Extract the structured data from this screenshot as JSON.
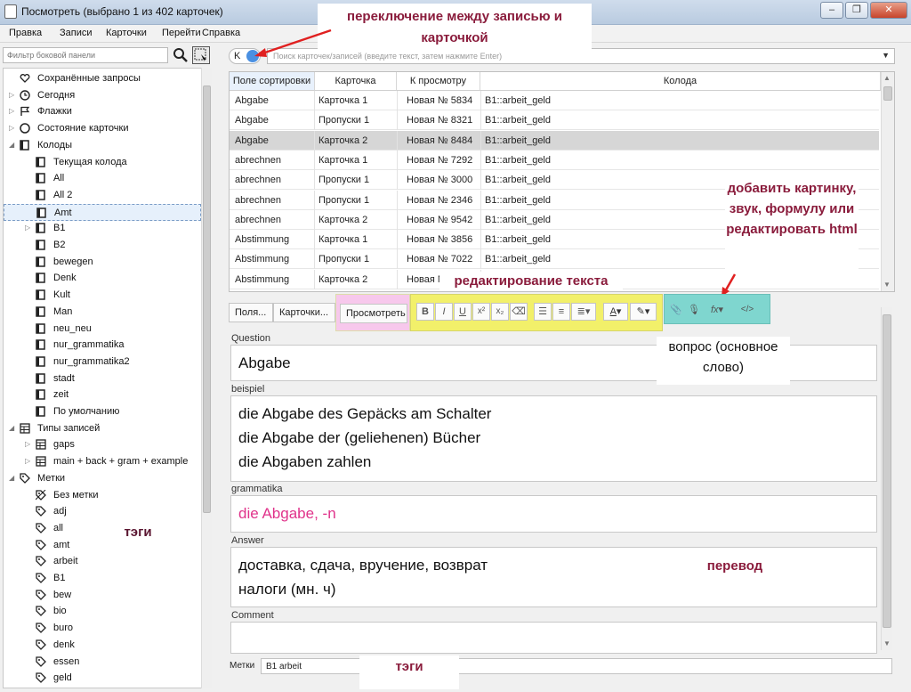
{
  "window": {
    "title": "Посмотреть (выбрано 1 из 402 карточек)",
    "controls": [
      "–",
      "❐",
      "✕"
    ]
  },
  "menu": [
    "Правка",
    "Записи",
    "Карточки",
    "Перейти",
    "Справка"
  ],
  "sidebar": {
    "filter_placeholder": "Фильтр боковой панели",
    "items": [
      {
        "label": "Сохранённые запросы",
        "icon": "heart-icon",
        "level": 0,
        "arrow": ""
      },
      {
        "label": "Сегодня",
        "icon": "clock-icon",
        "level": 0,
        "arrow": "▷"
      },
      {
        "label": "Флажки",
        "icon": "flag-icon",
        "level": 0,
        "arrow": "▷"
      },
      {
        "label": "Состояние карточки",
        "icon": "circle-icon",
        "level": 0,
        "arrow": "▷"
      },
      {
        "label": "Колоды",
        "icon": "deck-icon",
        "level": 0,
        "arrow": "◢"
      },
      {
        "label": "Текущая колода",
        "icon": "current-deck-icon",
        "level": 1,
        "arrow": ""
      },
      {
        "label": "All",
        "icon": "deck-icon",
        "level": 1,
        "arrow": ""
      },
      {
        "label": "All 2",
        "icon": "deck-icon",
        "level": 1,
        "arrow": ""
      },
      {
        "label": "Amt",
        "icon": "deck-icon",
        "level": 1,
        "arrow": "",
        "selected": true
      },
      {
        "label": "B1",
        "icon": "deck-icon",
        "level": 1,
        "arrow": "▷"
      },
      {
        "label": "B2",
        "icon": "deck-icon",
        "level": 1,
        "arrow": ""
      },
      {
        "label": "bewegen",
        "icon": "deck-icon",
        "level": 1,
        "arrow": ""
      },
      {
        "label": "Denk",
        "icon": "deck-icon",
        "level": 1,
        "arrow": ""
      },
      {
        "label": "Kult",
        "icon": "deck-icon",
        "level": 1,
        "arrow": ""
      },
      {
        "label": "Man",
        "icon": "deck-icon",
        "level": 1,
        "arrow": ""
      },
      {
        "label": "neu_neu",
        "icon": "deck-icon",
        "level": 1,
        "arrow": ""
      },
      {
        "label": "nur_grammatika",
        "icon": "deck-icon",
        "level": 1,
        "arrow": ""
      },
      {
        "label": "nur_grammatika2",
        "icon": "deck-icon",
        "level": 1,
        "arrow": ""
      },
      {
        "label": "stadt",
        "icon": "deck-icon",
        "level": 1,
        "arrow": ""
      },
      {
        "label": "zeit",
        "icon": "deck-icon",
        "level": 1,
        "arrow": ""
      },
      {
        "label": "По умолчанию",
        "icon": "deck-icon",
        "level": 1,
        "arrow": ""
      },
      {
        "label": "Типы записей",
        "icon": "note-type-icon",
        "level": 0,
        "arrow": "◢"
      },
      {
        "label": "gaps",
        "icon": "note-type-icon",
        "level": 1,
        "arrow": "▷"
      },
      {
        "label": "main + back + gram + example",
        "icon": "note-type-icon",
        "level": 1,
        "arrow": "▷"
      },
      {
        "label": "Метки",
        "icon": "tag-icon",
        "level": 0,
        "arrow": "◢"
      },
      {
        "label": "Без метки",
        "icon": "no-tag-icon",
        "level": 1,
        "arrow": ""
      },
      {
        "label": "adj",
        "icon": "tag-icon",
        "level": 1,
        "arrow": ""
      },
      {
        "label": "all",
        "icon": "tag-icon",
        "level": 1,
        "arrow": ""
      },
      {
        "label": "amt",
        "icon": "tag-icon",
        "level": 1,
        "arrow": ""
      },
      {
        "label": "arbeit",
        "icon": "tag-icon",
        "level": 1,
        "arrow": ""
      },
      {
        "label": "B1",
        "icon": "tag-icon",
        "level": 1,
        "arrow": ""
      },
      {
        "label": "bew",
        "icon": "tag-icon",
        "level": 1,
        "arrow": ""
      },
      {
        "label": "bio",
        "icon": "tag-icon",
        "level": 1,
        "arrow": ""
      },
      {
        "label": "buro",
        "icon": "tag-icon",
        "level": 1,
        "arrow": ""
      },
      {
        "label": "denk",
        "icon": "tag-icon",
        "level": 1,
        "arrow": ""
      },
      {
        "label": "essen",
        "icon": "tag-icon",
        "level": 1,
        "arrow": ""
      },
      {
        "label": "geld",
        "icon": "tag-icon",
        "level": 1,
        "arrow": ""
      }
    ]
  },
  "toggle": {
    "label": "K"
  },
  "search": {
    "placeholder": "Поиск карточек/записей (введите текст, затем нажмите Enter)"
  },
  "table": {
    "columns": [
      "Поле сортировки",
      "Карточка",
      "К просмотру",
      "Колода"
    ],
    "rows": [
      [
        "Abgabe",
        "Карточка 1",
        "Новая № 5834",
        "B1::arbeit_geld"
      ],
      [
        "Abgabe",
        "Пропуски 1",
        "Новая № 8321",
        "B1::arbeit_geld"
      ],
      [
        "Abgabe",
        "Карточка 2",
        "Новая № 8484",
        "B1::arbeit_geld"
      ],
      [
        "abrechnen",
        "Карточка 1",
        "Новая № 7292",
        "B1::arbeit_geld"
      ],
      [
        "abrechnen",
        "Пропуски 1",
        "Новая № 3000",
        "B1::arbeit_geld"
      ],
      [
        "abrechnen",
        "Пропуски 1",
        "Новая № 2346",
        "B1::arbeit_geld"
      ],
      [
        "abrechnen",
        "Карточка 2",
        "Новая № 9542",
        "B1::arbeit_geld"
      ],
      [
        "Abstimmung",
        "Карточка 1",
        "Новая № 3856",
        "B1::arbeit_geld"
      ],
      [
        "Abstimmung",
        "Пропуски 1",
        "Новая № 7022",
        "B1::arbeit_geld"
      ],
      [
        "Abstimmung",
        "Карточка 2",
        "Новая N",
        ""
      ]
    ]
  },
  "editor": {
    "tabs": [
      "Поля...",
      "Карточки...",
      "Просмотреть"
    ],
    "fields": [
      {
        "label": "Question",
        "lines": [
          "Abgabe"
        ]
      },
      {
        "label": "beispiel",
        "lines": [
          "die Abgabe des Gepäcks am Schalter",
          "die Abgabe der (geliehenen) Bücher",
          "die Abgaben zahlen"
        ]
      },
      {
        "label": "grammatika",
        "lines": [
          "die Abgabe, -n"
        ]
      },
      {
        "label": "Answer",
        "lines": [
          "доставка, сдача, вручение, возврат",
          "налоги (мн. ч)"
        ]
      },
      {
        "label": "Comment",
        "lines": []
      }
    ],
    "tags_label": "Метки",
    "tags_value": "B1 arbeit"
  },
  "annotations": {
    "toggle": "переключение между записью и карточкой",
    "media": "добавить картинку, звук, формулу или редактировать html",
    "text_edit": "редактирование текста",
    "question": "вопрос (основное слово)",
    "tags_side": "тэги",
    "translation": "перевод",
    "tags_bottom": "тэги"
  },
  "colors": {
    "preview_highlight": "#f7c8ec",
    "format_highlight": "#f2f06a",
    "media_highlight": "#7fd6cf",
    "annotation_text": "#8a1c3c",
    "arrow": "#e02020",
    "grammar_text": "#e0338b"
  }
}
